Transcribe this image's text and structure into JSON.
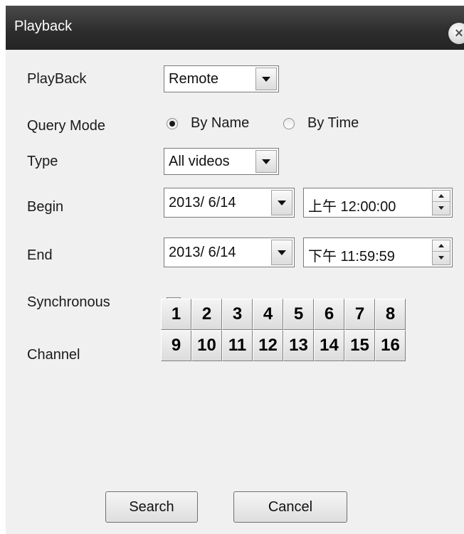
{
  "window": {
    "title": "Playback",
    "close_icon": "close-icon",
    "close_glyph": "×"
  },
  "form": {
    "playback": {
      "label": "PlayBack",
      "value": "Remote"
    },
    "query_mode": {
      "label": "Query Mode",
      "options": [
        {
          "label": "By Name",
          "selected": true
        },
        {
          "label": "By Time",
          "selected": false
        }
      ]
    },
    "type": {
      "label": "Type",
      "value": "All videos"
    },
    "begin": {
      "label": "Begin",
      "date": "2013/  6/14",
      "time": "上午 12:00:00"
    },
    "end": {
      "label": "End",
      "date": "2013/  6/14",
      "time": "下午 11:59:59"
    },
    "synchronous": {
      "label": "Synchronous",
      "checked": false
    },
    "channel": {
      "label": "Channel",
      "buttons": [
        "1",
        "2",
        "3",
        "4",
        "5",
        "6",
        "7",
        "8",
        "9",
        "10",
        "11",
        "12",
        "13",
        "14",
        "15",
        "16"
      ]
    }
  },
  "actions": {
    "search_label": "Search",
    "cancel_label": "Cancel"
  },
  "colors": {
    "titlebar": "#2e2e2e",
    "dialog_bg": "#f0f0f0",
    "title_text": "#ffffff"
  }
}
